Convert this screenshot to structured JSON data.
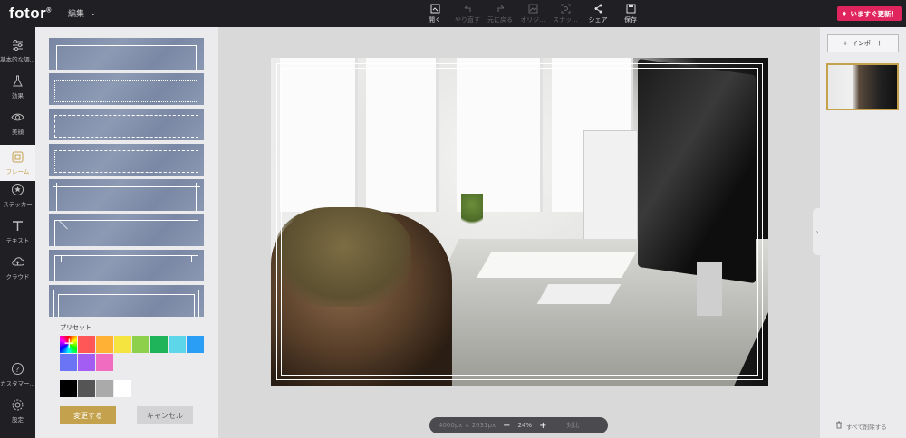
{
  "app": {
    "logo": "fotor",
    "logo_mark": "®",
    "menu_edit": "編集",
    "upgrade_label": "いますぐ更新！"
  },
  "toolbar": [
    {
      "label": "開く",
      "icon": "open-icon",
      "enabled": true
    },
    {
      "label": "やり直す",
      "icon": "undo-icon",
      "enabled": false
    },
    {
      "label": "元に戻る",
      "icon": "redo-icon",
      "enabled": false
    },
    {
      "label": "オリジ...",
      "icon": "original-icon",
      "enabled": false
    },
    {
      "label": "スナッ...",
      "icon": "snapshot-icon",
      "enabled": false
    },
    {
      "label": "シェア",
      "icon": "share-icon",
      "enabled": true
    },
    {
      "label": "保存",
      "icon": "save-icon",
      "enabled": true
    }
  ],
  "rail": [
    {
      "label": "基本的な調...",
      "icon": "sliders-icon",
      "active": false
    },
    {
      "label": "効果",
      "icon": "flask-icon",
      "active": false
    },
    {
      "label": "美顔",
      "icon": "eye-icon",
      "active": false
    },
    {
      "label": "フレーム",
      "icon": "frame-icon",
      "active": true
    },
    {
      "label": "ステッカー",
      "icon": "sticker-icon",
      "active": false
    },
    {
      "label": "テキスト",
      "icon": "text-icon",
      "active": false
    },
    {
      "label": "クラウド",
      "icon": "cloud-icon",
      "active": false
    },
    {
      "label": "カスタマー...",
      "icon": "help-icon",
      "active": false
    },
    {
      "label": "設定",
      "icon": "gear-icon",
      "active": false
    }
  ],
  "panel": {
    "preset_label": "プリセット",
    "colors": [
      "#ff5757",
      "#ffb135",
      "#f5e33f",
      "#8dd04b",
      "#1fb35a",
      "#5cd6e8",
      "#2a9df4",
      "#6b74f5",
      "#a35df2",
      "#f06cc1"
    ],
    "grays": [
      "#000000",
      "#555555",
      "#aaaaaa",
      "#ffffff"
    ],
    "apply_label": "変更する",
    "cancel_label": "キャンセル"
  },
  "zoom": {
    "size_label": "4000px × 2631px",
    "zoom_label": "24%",
    "compare_label": "対比",
    "minus": "−",
    "plus": "+"
  },
  "right": {
    "import_label": "インポート",
    "delete_all_label": "すべて削除する"
  }
}
